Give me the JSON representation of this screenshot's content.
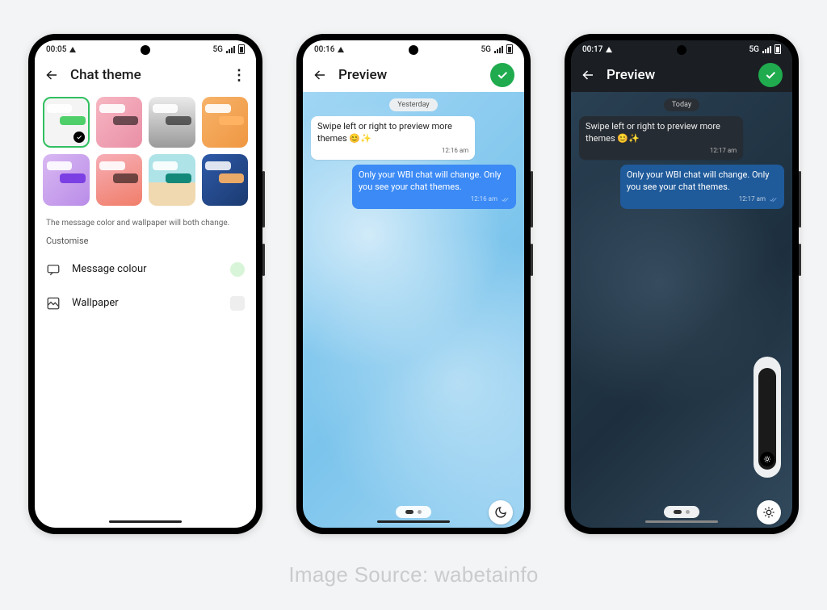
{
  "caption": "Image Source: wabetainfo",
  "phone1": {
    "status": {
      "time": "00:05",
      "net": "5G"
    },
    "appbar": {
      "title": "Chat theme"
    },
    "note": "The message color and wallpaper will both change.",
    "customise_label": "Customise",
    "row_color": "Message colour",
    "row_wallpaper": "Wallpaper"
  },
  "phone2": {
    "status": {
      "time": "00:16",
      "net": "5G"
    },
    "appbar": {
      "title": "Preview"
    },
    "date_chip": "Yesterday",
    "msg_in": "Swipe left or right to preview more themes 😊✨",
    "msg_in_time": "12:16 am",
    "msg_out": "Only your WBI chat will change. Only you see your chat themes.",
    "msg_out_time": "12:16 am"
  },
  "phone3": {
    "status": {
      "time": "00:17",
      "net": "5G"
    },
    "appbar": {
      "title": "Preview"
    },
    "date_chip": "Today",
    "msg_in": "Swipe left or right to preview more themes 😊✨",
    "msg_in_time": "12:17 am",
    "msg_out": "Only your WBI chat will change. Only you see your chat themes.",
    "msg_out_time": "12:17 am"
  }
}
